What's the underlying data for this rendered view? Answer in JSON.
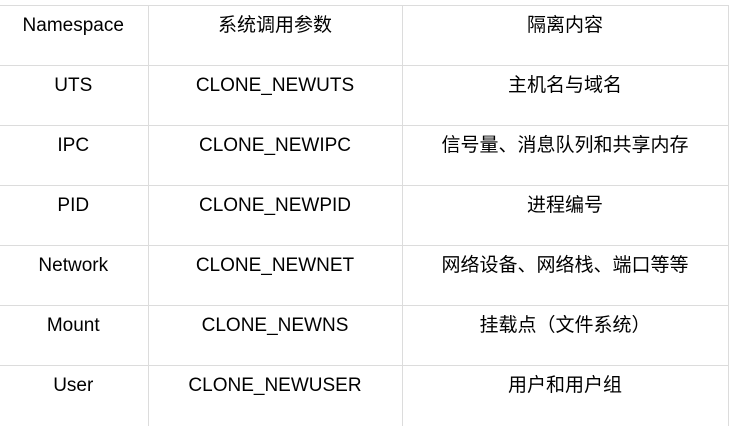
{
  "headers": [
    "Namespace",
    "系统调用参数",
    "隔离内容"
  ],
  "rows": [
    [
      "UTS",
      "CLONE_NEWUTS",
      "主机名与域名"
    ],
    [
      "IPC",
      "CLONE_NEWIPC",
      "信号量、消息队列和共享内存"
    ],
    [
      "PID",
      "CLONE_NEWPID",
      "进程编号"
    ],
    [
      "Network",
      "CLONE_NEWNET",
      "网络设备、网络栈、端口等等"
    ],
    [
      "Mount",
      "CLONE_NEWNS",
      "挂载点（文件系统）"
    ],
    [
      "User",
      "CLONE_NEWUSER",
      "用户和用户组"
    ]
  ]
}
